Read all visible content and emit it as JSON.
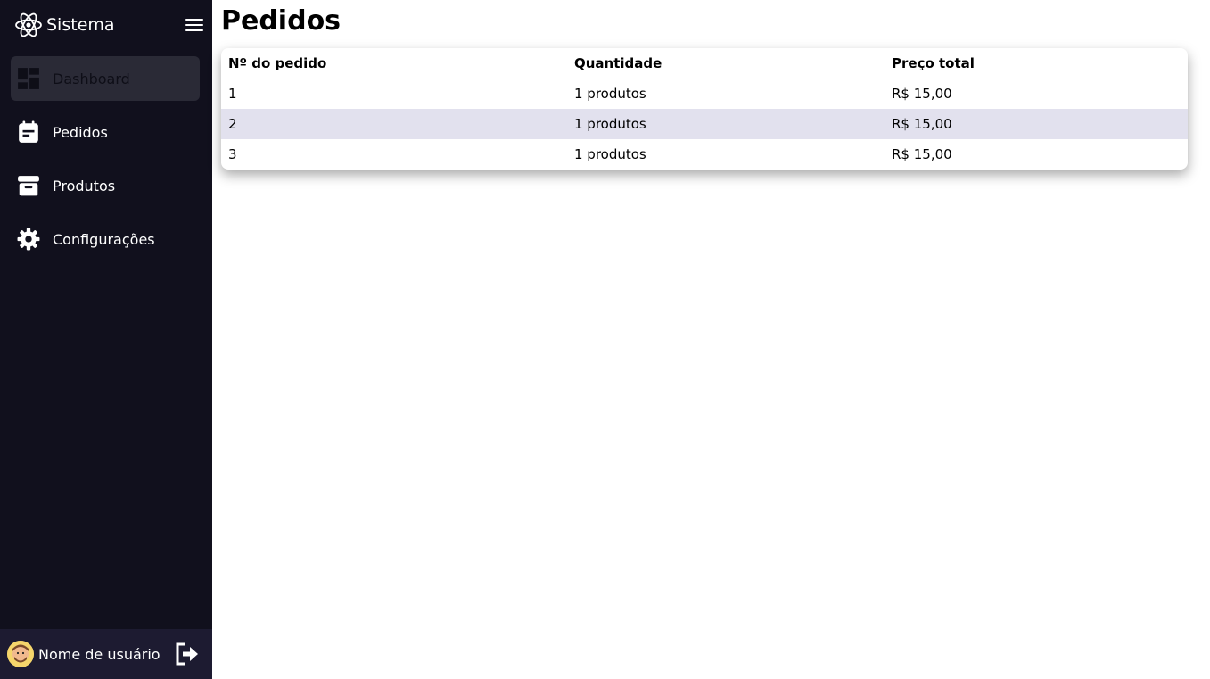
{
  "app": {
    "name": "Sistema"
  },
  "sidebar": {
    "items": [
      {
        "label": "Dashboard",
        "icon": "dashboard-icon",
        "active": true
      },
      {
        "label": "Pedidos",
        "icon": "clipboard-icon"
      },
      {
        "label": "Produtos",
        "icon": "archive-box-icon"
      },
      {
        "label": "Configurações",
        "icon": "gear-icon"
      }
    ]
  },
  "profile": {
    "name": "Nome de usuário"
  },
  "page": {
    "title": "Pedidos"
  },
  "table": {
    "headers": [
      "Nº do pedido",
      "Quantidade",
      "Preço total"
    ],
    "rows": [
      [
        "1",
        "1 produtos",
        "R$ 15,00"
      ],
      [
        "2",
        "1 produtos",
        "R$ 15,00"
      ],
      [
        "3",
        "1 produtos",
        "R$ 15,00"
      ]
    ]
  },
  "colors": {
    "sidebar_bg": "#11101d",
    "profile_bg": "#1d1b31",
    "active_item_bg": "#2a2a36",
    "row_alt_bg": "#e2e1ee"
  }
}
